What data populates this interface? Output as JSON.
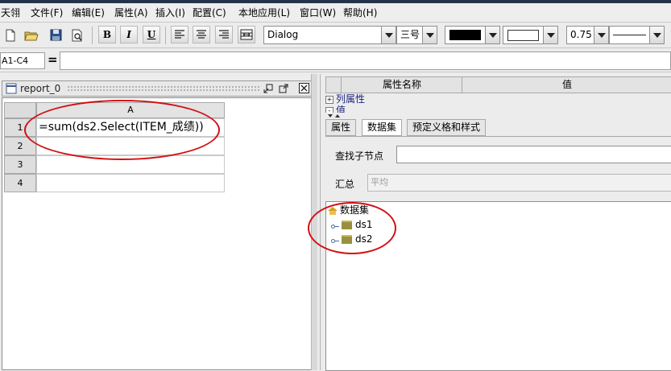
{
  "menubar": {
    "items": [
      "天翎",
      "文件(F)",
      "编辑(E)",
      "属性(A)",
      "插入(I)",
      "配置(C)",
      "本地应用(L)",
      "窗口(W)",
      "帮助(H)"
    ]
  },
  "toolbar": {
    "bold": "B",
    "italic": "I",
    "underline": "U",
    "font_name": "Dialog",
    "font_size": "三号",
    "line_width": "0.75",
    "colors": {
      "foreground": "#000000",
      "background": "#ffffff"
    }
  },
  "formula_bar": {
    "cell_ref": "A1-C4",
    "equals": "=",
    "value": ""
  },
  "report": {
    "title": "report_0",
    "column_headers": [
      "A"
    ],
    "rows": [
      {
        "num": "1",
        "value": "=sum(ds2.Select(ITEM_成绩))"
      },
      {
        "num": "2",
        "value": ""
      },
      {
        "num": "3",
        "value": ""
      },
      {
        "num": "4",
        "value": ""
      }
    ]
  },
  "properties": {
    "header_name": "属性名称",
    "header_value": "值",
    "rows": [
      {
        "expander": "+",
        "label": "列属性"
      },
      {
        "expander": "-",
        "label": "值"
      }
    ]
  },
  "tabs": [
    {
      "label": "属性",
      "active": false
    },
    {
      "label": "数据集",
      "active": true
    },
    {
      "label": "预定义格和样式",
      "active": false
    }
  ],
  "dataset_panel": {
    "find_label": "查找子节点",
    "summary_label": "汇总",
    "summary_value": "平均",
    "tree": {
      "root": "数据集",
      "children": [
        "ds1",
        "ds2"
      ]
    }
  },
  "colors": {
    "annotation": "#d30f12",
    "title_bar": "#25334a"
  }
}
